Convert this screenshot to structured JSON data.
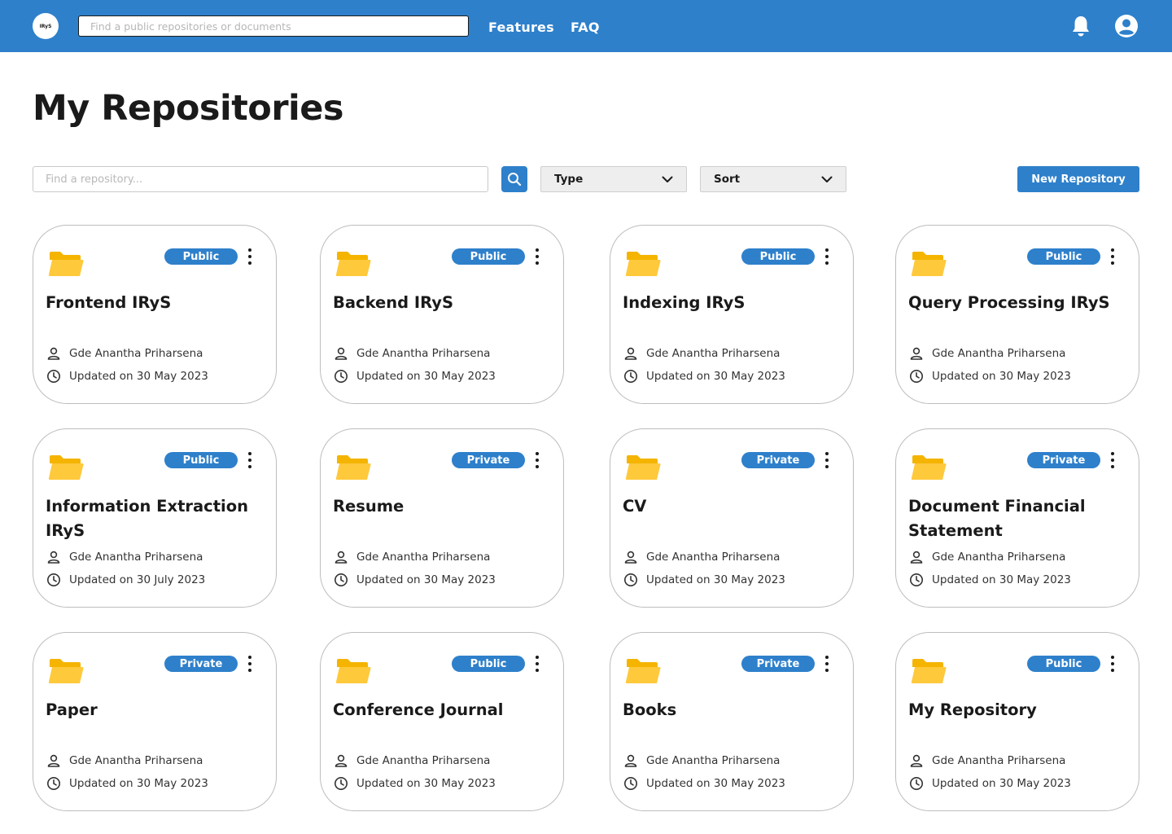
{
  "header": {
    "logo_text": "IRyS",
    "search_placeholder": "Find a public repositories or documents",
    "nav": {
      "features": "Features",
      "faq": "FAQ"
    },
    "icons": {
      "notifications": "bell-icon",
      "profile": "user-circle-icon"
    }
  },
  "page": {
    "title": "My Repositories"
  },
  "toolbar": {
    "search_placeholder": "Find a repository...",
    "type_label": "Type",
    "sort_label": "Sort",
    "new_repo_label": "New Repository"
  },
  "colors": {
    "brand": "#2e80cb",
    "folder": "#ffc93c",
    "text": "#1a1a1a"
  },
  "repos": [
    {
      "name": "Frontend IRyS",
      "visibility": "Public",
      "owner": "Gde Anantha Priharsena",
      "updated": "Updated on 30 May 2023"
    },
    {
      "name": "Backend IRyS",
      "visibility": "Public",
      "owner": "Gde Anantha Priharsena",
      "updated": "Updated on 30 May 2023"
    },
    {
      "name": "Indexing IRyS",
      "visibility": "Public",
      "owner": "Gde Anantha Priharsena",
      "updated": "Updated on 30 May 2023"
    },
    {
      "name": "Query Processing IRyS",
      "visibility": "Public",
      "owner": "Gde Anantha Priharsena",
      "updated": "Updated on 30 May 2023"
    },
    {
      "name": "Information Extraction IRyS",
      "visibility": "Public",
      "owner": "Gde Anantha Priharsena",
      "updated": "Updated on 30 July 2023"
    },
    {
      "name": "Resume",
      "visibility": "Private",
      "owner": "Gde Anantha Priharsena",
      "updated": "Updated on 30 May 2023"
    },
    {
      "name": "CV",
      "visibility": "Private",
      "owner": "Gde Anantha Priharsena",
      "updated": "Updated on 30 May 2023"
    },
    {
      "name": "Document Financial Statement",
      "visibility": "Private",
      "owner": "Gde Anantha Priharsena",
      "updated": "Updated on 30 May 2023"
    },
    {
      "name": "Paper",
      "visibility": "Private",
      "owner": "Gde Anantha Priharsena",
      "updated": "Updated on 30 May 2023"
    },
    {
      "name": "Conference Journal",
      "visibility": "Public",
      "owner": "Gde Anantha Priharsena",
      "updated": "Updated on 30 May 2023"
    },
    {
      "name": "Books",
      "visibility": "Private",
      "owner": "Gde Anantha Priharsena",
      "updated": "Updated on 30 May 2023"
    },
    {
      "name": "My Repository",
      "visibility": "Public",
      "owner": "Gde Anantha Priharsena",
      "updated": "Updated on 30 May 2023"
    }
  ]
}
